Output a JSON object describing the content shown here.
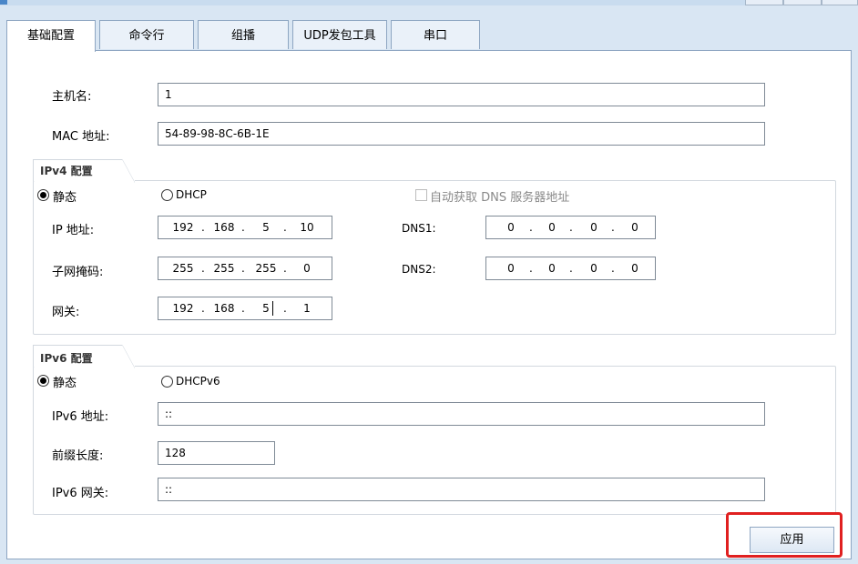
{
  "tabs": [
    "基础配置",
    "命令行",
    "组播",
    "UDP发包工具",
    "串口"
  ],
  "active_tab": 0,
  "hostname": {
    "label": "主机名:",
    "value": "1"
  },
  "mac": {
    "label": "MAC 地址:",
    "value": "54-89-98-8C-6B-1E"
  },
  "ipv4": {
    "title": "IPv4 配置",
    "static_label": "静态",
    "dhcp_label": "DHCP",
    "mode": "static",
    "auto_dns_label": "自动获取 DNS 服务器地址",
    "auto_dns_checked": false,
    "ip_label": "IP 地址:",
    "ip": [
      "192",
      "168",
      "5",
      "10"
    ],
    "mask_label": "子网掩码:",
    "mask": [
      "255",
      "255",
      "255",
      "0"
    ],
    "gateway_label": "网关:",
    "gateway": [
      "192",
      "168",
      "5",
      "1"
    ],
    "dns1_label": "DNS1:",
    "dns1": [
      "0",
      "0",
      "0",
      "0"
    ],
    "dns2_label": "DNS2:",
    "dns2": [
      "0",
      "0",
      "0",
      "0"
    ]
  },
  "ipv6": {
    "title": "IPv6 配置",
    "static_label": "静态",
    "dhcp_label": "DHCPv6",
    "mode": "static",
    "addr_label": "IPv6 地址:",
    "addr": "::",
    "prefix_label": "前缀长度:",
    "prefix": "128",
    "gateway_label": "IPv6 网关:",
    "gateway": "::"
  },
  "apply_label": "应用",
  "colors": {
    "highlight": "#e02020",
    "tab_border": "#8ea6c2",
    "background": "#d9e6f3"
  }
}
